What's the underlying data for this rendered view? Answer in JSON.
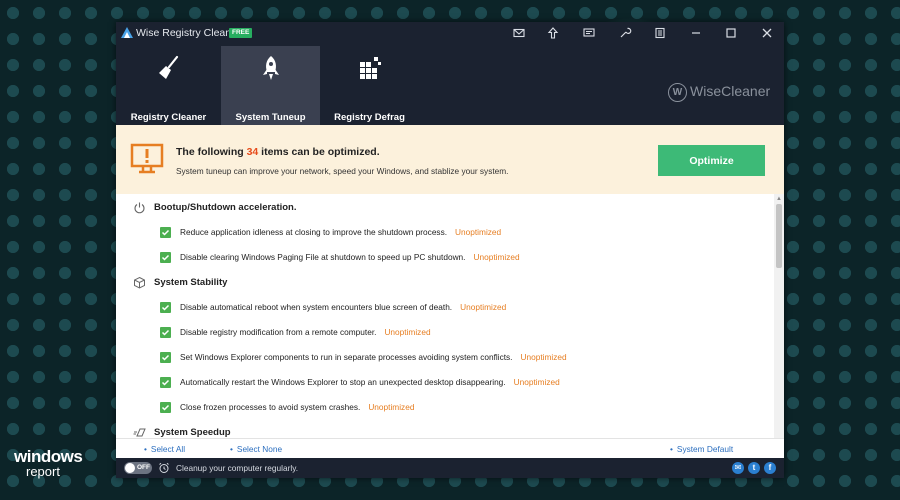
{
  "window": {
    "title": "Wise Registry Cleaner X",
    "badge": "FREE"
  },
  "titlebar_icons": [
    "mail-icon",
    "upgrade-icon",
    "feedback-icon",
    "tools-icon",
    "menu-icon",
    "minimize-icon",
    "maximize-icon",
    "close-icon"
  ],
  "nav": {
    "tabs": [
      {
        "label": "Registry Cleaner",
        "icon": "broom-icon",
        "active": false
      },
      {
        "label": "System Tuneup",
        "icon": "rocket-icon",
        "active": true
      },
      {
        "label": "Registry Defrag",
        "icon": "defrag-icon",
        "active": false
      }
    ],
    "brand": "WiseCleaner",
    "brand_mark": "W"
  },
  "banner": {
    "headline_prefix": "The following ",
    "count": "34",
    "headline_suffix": " items can be optimized.",
    "subtext": "System tuneup can improve your network, speed your Windows, and stablize your system.",
    "optimize_label": "Optimize"
  },
  "sections": [
    {
      "title": "Bootup/Shutdown acceleration.",
      "icon": "power-icon",
      "items": [
        {
          "text": "Reduce application idleness at closing to improve the shutdown process.",
          "status": "Unoptimized"
        },
        {
          "text": "Disable clearing Windows Paging File at shutdown to speed up PC shutdown.",
          "status": "Unoptimized"
        }
      ]
    },
    {
      "title": "System Stability",
      "icon": "cube-icon",
      "items": [
        {
          "text": "Disable automatical reboot when system encounters blue screen of death.",
          "status": "Unoptimized"
        },
        {
          "text": "Disable registry modification from a remote computer.",
          "status": "Unoptimized"
        },
        {
          "text": "Set Windows Explorer components to run in separate processes avoiding system conflicts.",
          "status": "Unoptimized"
        },
        {
          "text": "Automatically restart the Windows Explorer to stop an unexpected desktop disappearing.",
          "status": "Unoptimized"
        },
        {
          "text": "Close frozen processes to avoid system crashes.",
          "status": "Unoptimized"
        }
      ]
    },
    {
      "title": "System Speedup",
      "icon": "speed-icon",
      "items": []
    }
  ],
  "selection": {
    "select_all": "Select All",
    "select_none": "Select None",
    "system_default": "System Default"
  },
  "status": {
    "toggle_label": "OFF",
    "text": "Cleanup your computer regularly."
  },
  "watermark": {
    "line1": "windows",
    "line2": "report"
  },
  "colors": {
    "titlebar": "#1b2230",
    "active_tab": "#3a4050",
    "banner_bg": "#fcf1dc",
    "accent_orange": "#e64a19",
    "optimize_green": "#3dba77",
    "check_green": "#4caf50",
    "status_orange": "#e67e22",
    "link_blue": "#2c6fbf"
  }
}
